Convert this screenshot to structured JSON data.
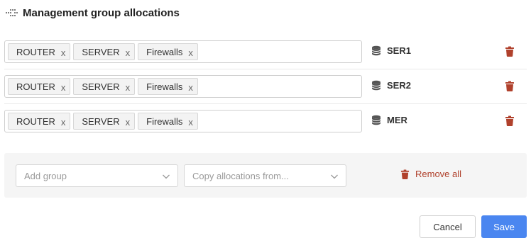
{
  "header": {
    "title": "Management group allocations",
    "icon": "grip-dots-icon"
  },
  "rows": [
    {
      "tags": [
        "ROUTER",
        "SERVER",
        "Firewalls"
      ],
      "group": "SER1"
    },
    {
      "tags": [
        "ROUTER",
        "SERVER",
        "Firewalls"
      ],
      "group": "SER2"
    },
    {
      "tags": [
        "ROUTER",
        "SERVER",
        "Firewalls"
      ],
      "group": "MER"
    }
  ],
  "tag_remove_glyph": "x",
  "controls": {
    "add_group_placeholder": "Add group",
    "copy_allocations_placeholder": "Copy allocations from...",
    "remove_all_label": "Remove all"
  },
  "footer": {
    "cancel_label": "Cancel",
    "save_label": "Save"
  },
  "colors": {
    "accent": "#4a86f0",
    "danger": "#b0412c",
    "panel_bg": "#f5f5f5"
  }
}
